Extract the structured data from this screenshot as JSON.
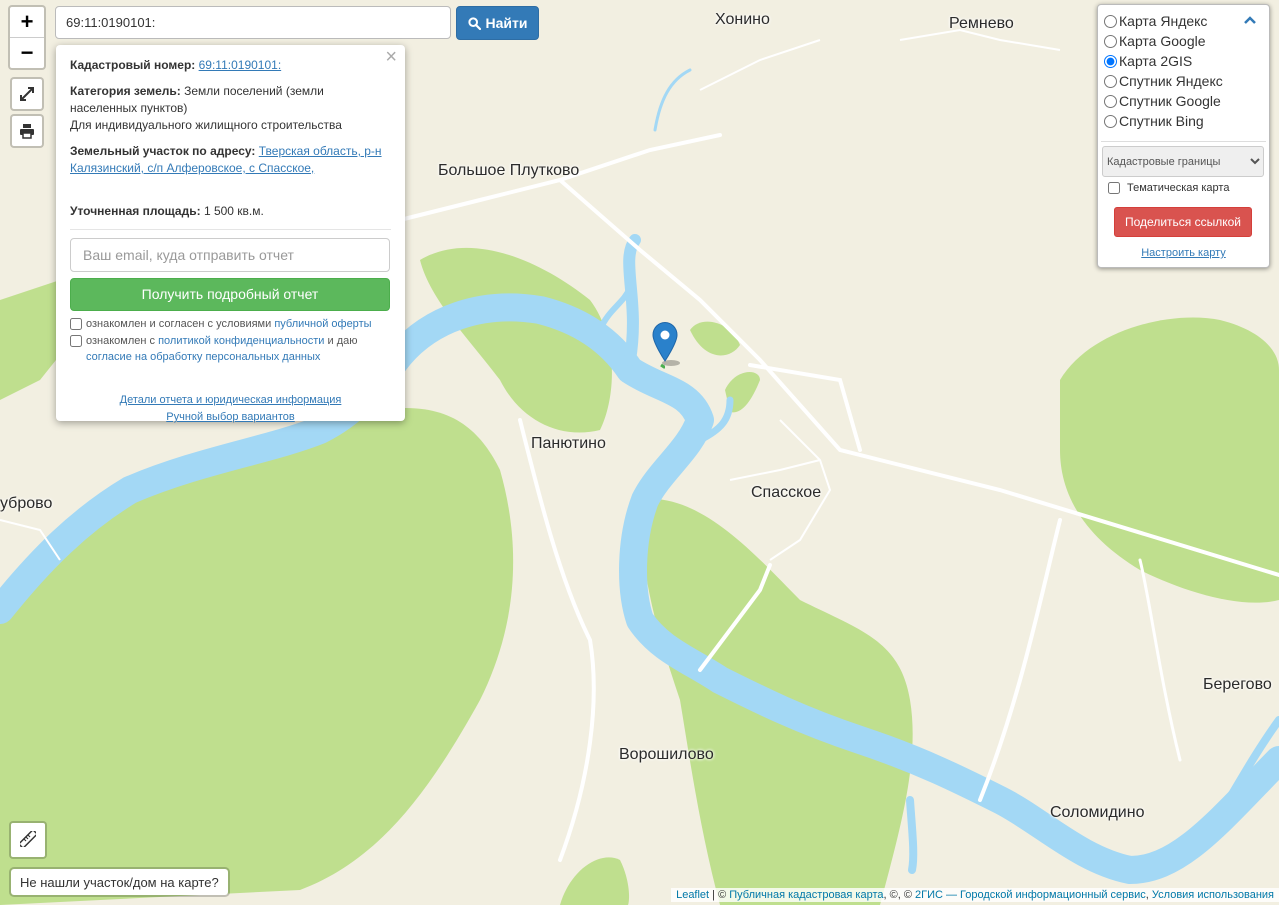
{
  "search": {
    "value": "69:11:0190101:",
    "button_label": "Найти"
  },
  "zoom": {
    "in_label": "+",
    "out_label": "−"
  },
  "popup": {
    "cadastral_label": "Кадастровый номер:",
    "cadastral_value": "69:11:0190101:",
    "category_label": "Категория земель:",
    "category_value": "Земли поселений (земли населенных пунктов)",
    "usage": "Для индивидуального жилищного строительства",
    "address_label": "Земельный участок по адресу:",
    "address_value": "Тверская область, р-н Калязинский, с/п Алферовское, с Спасское,",
    "area_label": "Уточненная площадь:",
    "area_value": "1 500 кв.м.",
    "email_placeholder": "Ваш email, куда отправить отчет",
    "report_button": "Получить подробный отчет",
    "consent1_text": "ознакомлен и согласен с условиями",
    "consent1_link": "публичной оферты",
    "consent2_text": "ознакомлен с",
    "consent2_link": "политикой конфиденциальности",
    "consent2_and": "и даю",
    "consent2_link2": "согласие на обработку персональных данных",
    "details_link": "Детали отчета и юридическая информация",
    "manual_link": "Ручной выбор вариантов",
    "close": "×"
  },
  "layers": {
    "options": [
      "Карта Яндекс",
      "Карта Google",
      "Карта 2GIS",
      "Спутник Яндекс",
      "Спутник Google",
      "Спутник Bing"
    ],
    "selected": "Карта 2GIS",
    "select_value": "Кадастровые границы",
    "thematic_label": "Тематическая карта",
    "share_button": "Поделиться ссылкой",
    "settings_link": "Настроить карту"
  },
  "places": {
    "khonino": "Хонино",
    "remnevo": "Ремнево",
    "bolshoe_plutkovo": "Большое Плутково",
    "panyutino": "Панютино",
    "spasskoe": "Спасское",
    "ubrovo": "уброво",
    "voroshilovo": "Ворошилово",
    "solomidino": "Соломидино",
    "beregovo": "Берегово"
  },
  "not_found": "Не нашли участок/дом на карте?",
  "attribution": {
    "leaflet": "Leaflet",
    "sep1": " | © ",
    "pkk": "Публичная кадастровая карта",
    "sep2": ", ©, © ",
    "gis": "2ГИС — Городской информационный сервис",
    "sep3": ", ",
    "terms": "Условия использования"
  },
  "colors": {
    "land": "#f2efe1",
    "forest": "#bfdf8e",
    "water": "#a3d8f5",
    "marker": "#2a81cb",
    "road": "#ffffff"
  }
}
